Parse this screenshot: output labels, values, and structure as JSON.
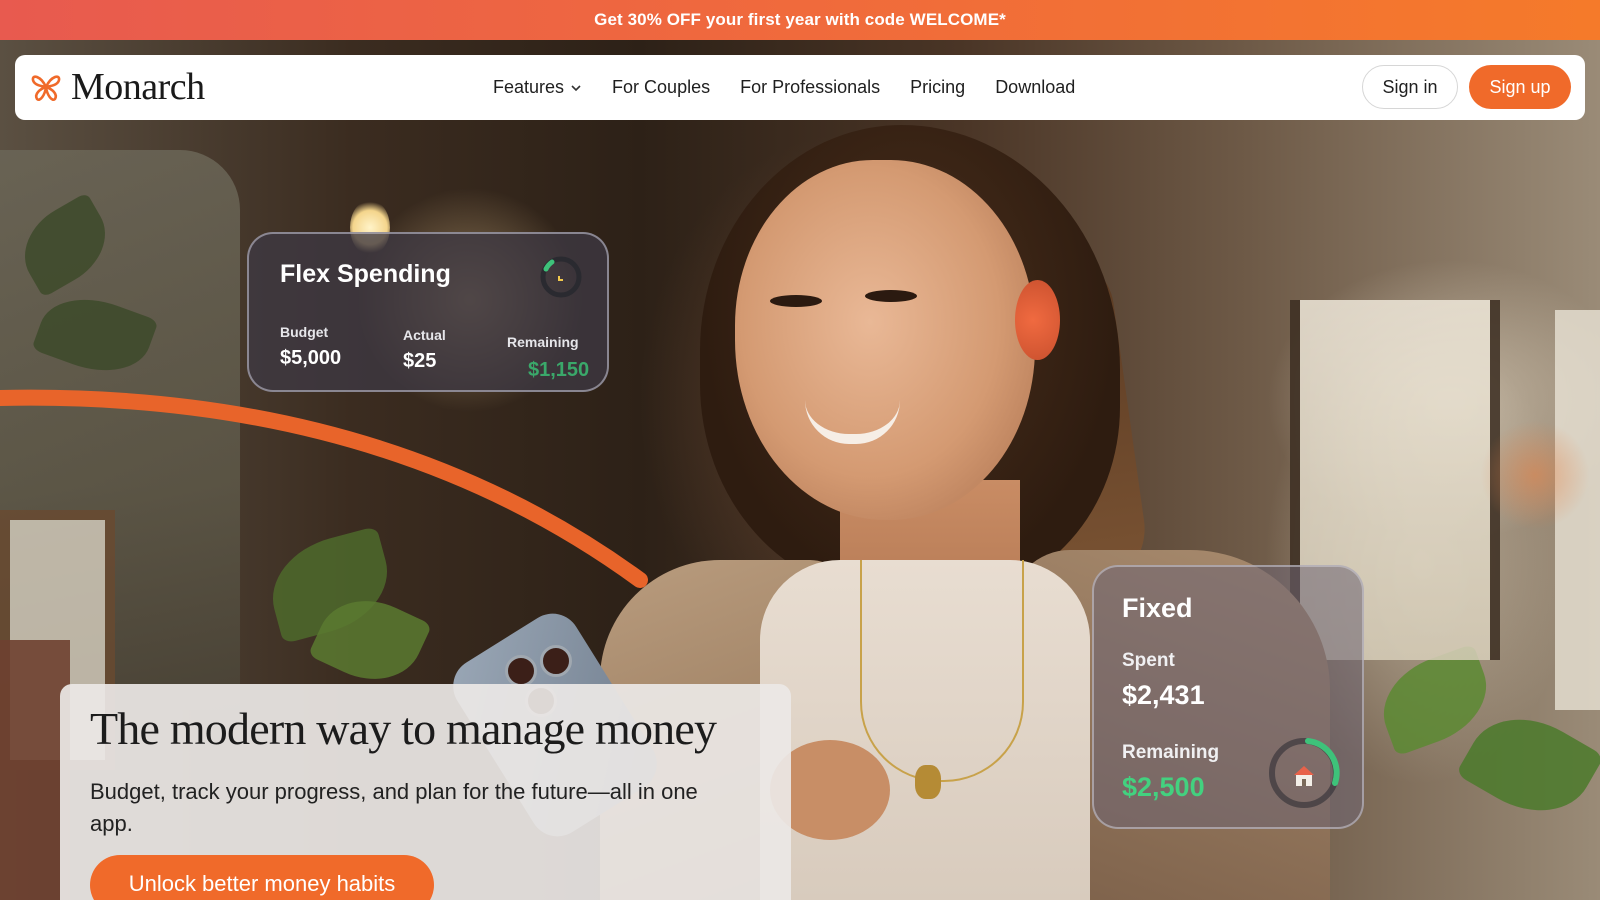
{
  "promo": {
    "text": "Get 30% OFF your first year with code WELCOME*"
  },
  "nav": {
    "brand": "Monarch",
    "items": [
      {
        "label": "Features",
        "has_dropdown": true
      },
      {
        "label": "For Couples"
      },
      {
        "label": "For Professionals"
      },
      {
        "label": "Pricing"
      },
      {
        "label": "Download"
      }
    ],
    "sign_in": "Sign in",
    "sign_up": "Sign up"
  },
  "flex_card": {
    "title": "Flex Spending",
    "budget_label": "Budget",
    "budget_value": "$5,000",
    "actual_label": "Actual",
    "actual_value": "$25",
    "remaining_label": "Remaining",
    "remaining_value": "$1,150"
  },
  "fixed_card": {
    "title": "Fixed",
    "spent_label": "Spent",
    "spent_value": "$2,431",
    "remaining_label": "Remaining",
    "remaining_value": "$2,500"
  },
  "hero": {
    "headline": "The modern way to manage money",
    "subtitle": "Budget, track your progress, and plan for the future—all in one app.",
    "cta": "Unlock better money habits"
  },
  "colors": {
    "accent_orange": "#f06a2a",
    "positive_green": "#3ec27a",
    "promo_gradient_start": "#e85a4f",
    "promo_gradient_end": "#f57a2a"
  },
  "icons": {
    "logo": "butterfly-icon",
    "dropdown": "chevron-down-icon",
    "fixed_ring_center": "house-icon"
  }
}
